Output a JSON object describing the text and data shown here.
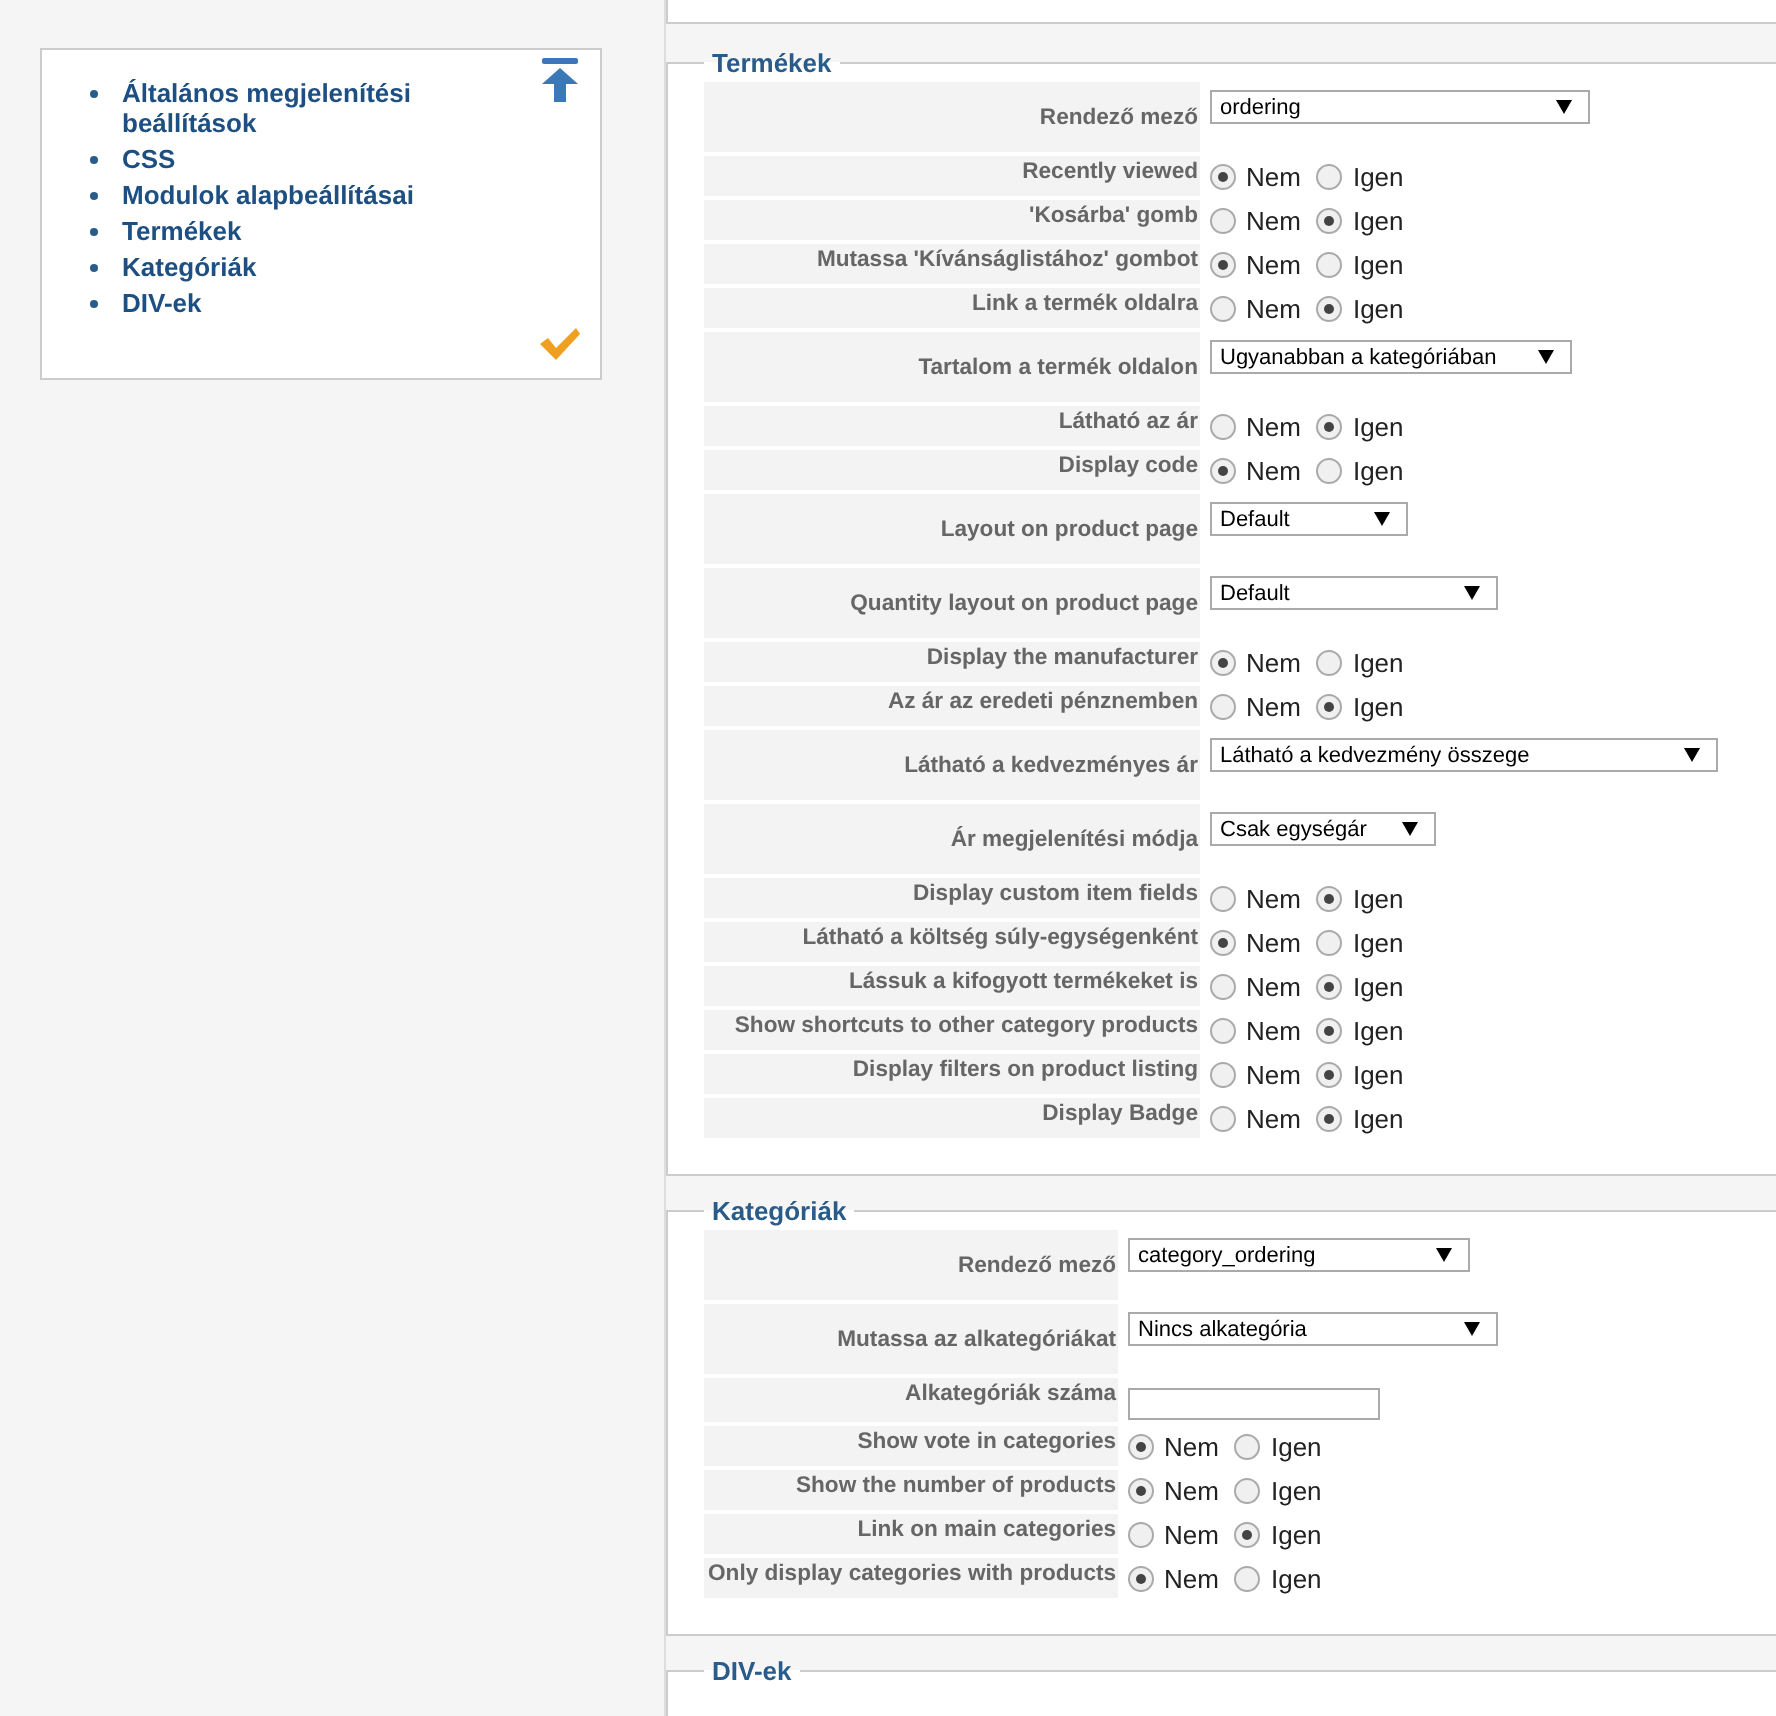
{
  "sidebar": {
    "items": [
      {
        "label": "Általános megjelenítési beállítások"
      },
      {
        "label": "CSS"
      },
      {
        "label": "Modulok alapbeállításai"
      },
      {
        "label": "Termékek"
      },
      {
        "label": "Kategóriák"
      },
      {
        "label": "DIV-ek"
      }
    ]
  },
  "sections": [
    {
      "title": "Termékek",
      "rows": [
        {
          "kind": "select",
          "label": "Rendező mező",
          "value": "ordering"
        },
        {
          "kind": "radio",
          "label": "Recently viewed",
          "options": [
            {
              "label": "Nem",
              "selected": true
            },
            {
              "label": "Igen",
              "selected": false
            }
          ]
        },
        {
          "kind": "radio",
          "label": "'Kosárba' gomb",
          "options": [
            {
              "label": "Nem",
              "selected": false
            },
            {
              "label": "Igen",
              "selected": true
            }
          ]
        },
        {
          "kind": "radio",
          "label": "Mutassa 'Kívánságlistához' gombot",
          "options": [
            {
              "label": "Nem",
              "selected": true
            },
            {
              "label": "Igen",
              "selected": false
            }
          ]
        },
        {
          "kind": "radio",
          "label": "Link a termék oldalra",
          "options": [
            {
              "label": "Nem",
              "selected": false
            },
            {
              "label": "Igen",
              "selected": true
            }
          ]
        },
        {
          "kind": "select",
          "label": "Tartalom a termék oldalon",
          "value": "Ugyanabban a kategóriában"
        },
        {
          "kind": "radio",
          "label": "Látható az ár",
          "options": [
            {
              "label": "Nem",
              "selected": false
            },
            {
              "label": "Igen",
              "selected": true
            }
          ]
        },
        {
          "kind": "radio",
          "label": "Display code",
          "options": [
            {
              "label": "Nem",
              "selected": true
            },
            {
              "label": "Igen",
              "selected": false
            }
          ]
        },
        {
          "kind": "select",
          "label": "Layout on product page",
          "value": "Default"
        },
        {
          "kind": "select",
          "label": "Quantity layout on product page",
          "value": "Default"
        },
        {
          "kind": "radio",
          "label": "Display the manufacturer",
          "options": [
            {
              "label": "Nem",
              "selected": true
            },
            {
              "label": "Igen",
              "selected": false
            }
          ]
        },
        {
          "kind": "radio",
          "label": "Az ár az eredeti pénznemben",
          "options": [
            {
              "label": "Nem",
              "selected": false
            },
            {
              "label": "Igen",
              "selected": true
            }
          ]
        },
        {
          "kind": "select",
          "label": "Látható a kedvezményes ár",
          "value": "Látható a kedvezmény összege"
        },
        {
          "kind": "select",
          "label": "Ár megjelenítési módja",
          "value": "Csak egységár"
        },
        {
          "kind": "radio",
          "label": "Display custom item fields",
          "options": [
            {
              "label": "Nem",
              "selected": false
            },
            {
              "label": "Igen",
              "selected": true
            }
          ]
        },
        {
          "kind": "radio",
          "label": "Látható a költség súly-egységenként",
          "options": [
            {
              "label": "Nem",
              "selected": true
            },
            {
              "label": "Igen",
              "selected": false
            }
          ]
        },
        {
          "kind": "radio",
          "label": "Lássuk a kifogyott termékeket is",
          "options": [
            {
              "label": "Nem",
              "selected": false
            },
            {
              "label": "Igen",
              "selected": true
            }
          ]
        },
        {
          "kind": "radio",
          "label": "Show shortcuts to other category products",
          "options": [
            {
              "label": "Nem",
              "selected": false
            },
            {
              "label": "Igen",
              "selected": true
            }
          ]
        },
        {
          "kind": "radio",
          "label": "Display filters on product listing",
          "options": [
            {
              "label": "Nem",
              "selected": false
            },
            {
              "label": "Igen",
              "selected": true
            }
          ]
        },
        {
          "kind": "radio",
          "label": "Display Badge",
          "options": [
            {
              "label": "Nem",
              "selected": false
            },
            {
              "label": "Igen",
              "selected": true
            }
          ]
        }
      ]
    },
    {
      "title": "Kategóriák",
      "rows": [
        {
          "kind": "select",
          "label": "Rendező mező",
          "value": "category_ordering"
        },
        {
          "kind": "select",
          "label": "Mutassa az alkategóriákat",
          "value": "Nincs alkategória"
        },
        {
          "kind": "input",
          "label": "Alkategóriák száma"
        },
        {
          "kind": "radio",
          "label": "Show vote in categories",
          "options": [
            {
              "label": "Nem",
              "selected": true
            },
            {
              "label": "Igen",
              "selected": false
            }
          ]
        },
        {
          "kind": "radio",
          "label": "Show the number of products",
          "options": [
            {
              "label": "Nem",
              "selected": true
            },
            {
              "label": "Igen",
              "selected": false
            }
          ]
        },
        {
          "kind": "radio",
          "label": "Link on main categories",
          "options": [
            {
              "label": "Nem",
              "selected": false
            },
            {
              "label": "Igen",
              "selected": true
            }
          ]
        },
        {
          "kind": "radio",
          "label": "Only display categories with products",
          "options": [
            {
              "label": "Nem",
              "selected": true
            },
            {
              "label": "Igen",
              "selected": false
            }
          ]
        }
      ]
    },
    {
      "title": "DIV-ek"
    }
  ]
}
